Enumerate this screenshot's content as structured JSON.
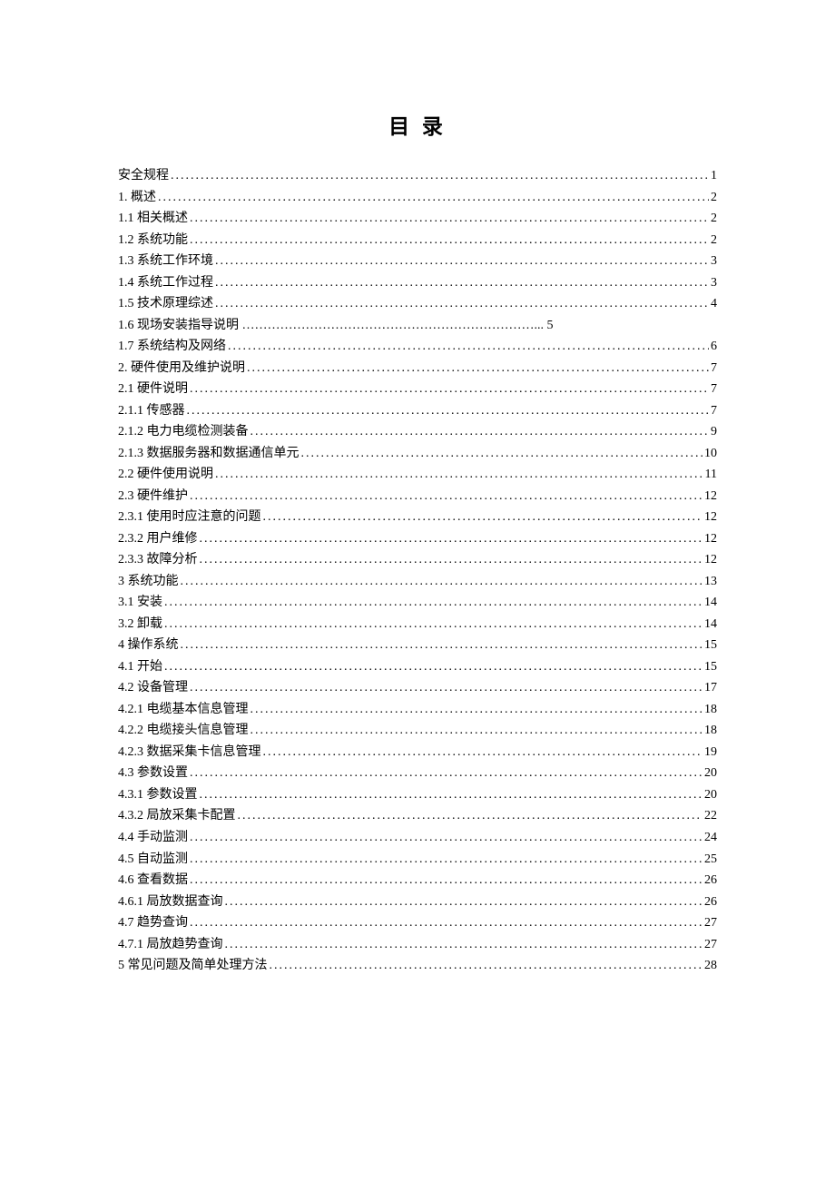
{
  "title": "目 录",
  "toc": [
    {
      "label": "安全规程",
      "page": "1"
    },
    {
      "label": "1.  概述",
      "page": "2"
    },
    {
      "label": "1.1  相关概述",
      "page": "2"
    },
    {
      "label": "1.2  系统功能",
      "page": "2"
    },
    {
      "label": "1.3  系统工作环境",
      "page": "3"
    },
    {
      "label": "1.4  系统工作过程",
      "page": "3"
    },
    {
      "label": "1.5  技术原理综述",
      "page": "4"
    },
    {
      "label": "1.6 现场安装指导说明  ……………………………………………………………...    5",
      "page": "",
      "nodots": true
    },
    {
      "label": "1.7 系统结构及网络",
      "page": "6"
    },
    {
      "label": "2.  硬件使用及维护说明",
      "page": "7"
    },
    {
      "label": "2.1 硬件说明",
      "page": "7"
    },
    {
      "label": "2.1.1 传感器",
      "page": "7"
    },
    {
      "label": "2.1.2  电力电缆检测装备",
      "page": "9"
    },
    {
      "label": "2.1.3 数据服务器和数据通信单元",
      "page": "10"
    },
    {
      "label": "2.2  硬件使用说明",
      "page": "11"
    },
    {
      "label": "2.3  硬件维护",
      "page": "12"
    },
    {
      "label": "2.3.1  使用时应注意的问题",
      "page": "12"
    },
    {
      "label": "2.3.2  用户维修",
      "page": "12"
    },
    {
      "label": "2.3.3  故障分析",
      "page": "12"
    },
    {
      "label": "3 系统功能",
      "page": "13"
    },
    {
      "label": "3.1        安装",
      "page": "14"
    },
    {
      "label": "3.2        卸载",
      "page": "14"
    },
    {
      "label": "4 操作系统",
      "page": "15"
    },
    {
      "label": "4.1        开始",
      "page": "15"
    },
    {
      "label": "4.2        设备管理",
      "page": "17"
    },
    {
      "label": "4.2.1        电缆基本信息管理",
      "page": "18"
    },
    {
      "label": "4.2.2        电缆接头信息管理",
      "page": "18"
    },
    {
      "label": "4.2.3        数据采集卡信息管理",
      "page": "19"
    },
    {
      "label": "4.3        参数设置",
      "page": "20"
    },
    {
      "label": "4.3.1        参数设置",
      "page": "20"
    },
    {
      "label": "4.3.2        局放采集卡配置",
      "page": "22"
    },
    {
      "label": "4.4 手动监测",
      "page": "24"
    },
    {
      "label": "4.5 自动监测",
      "page": "25"
    },
    {
      "label": "4.6 查看数据",
      "page": "26"
    },
    {
      "label": "4.6.1        局放数据查询",
      "page": "26"
    },
    {
      "label": "4.7  趋势查询",
      "page": "27"
    },
    {
      "label": "4.7.1 局放趋势查询",
      "page": "27"
    },
    {
      "label": "5          常见问题及简单处理方法",
      "page": "28"
    }
  ]
}
